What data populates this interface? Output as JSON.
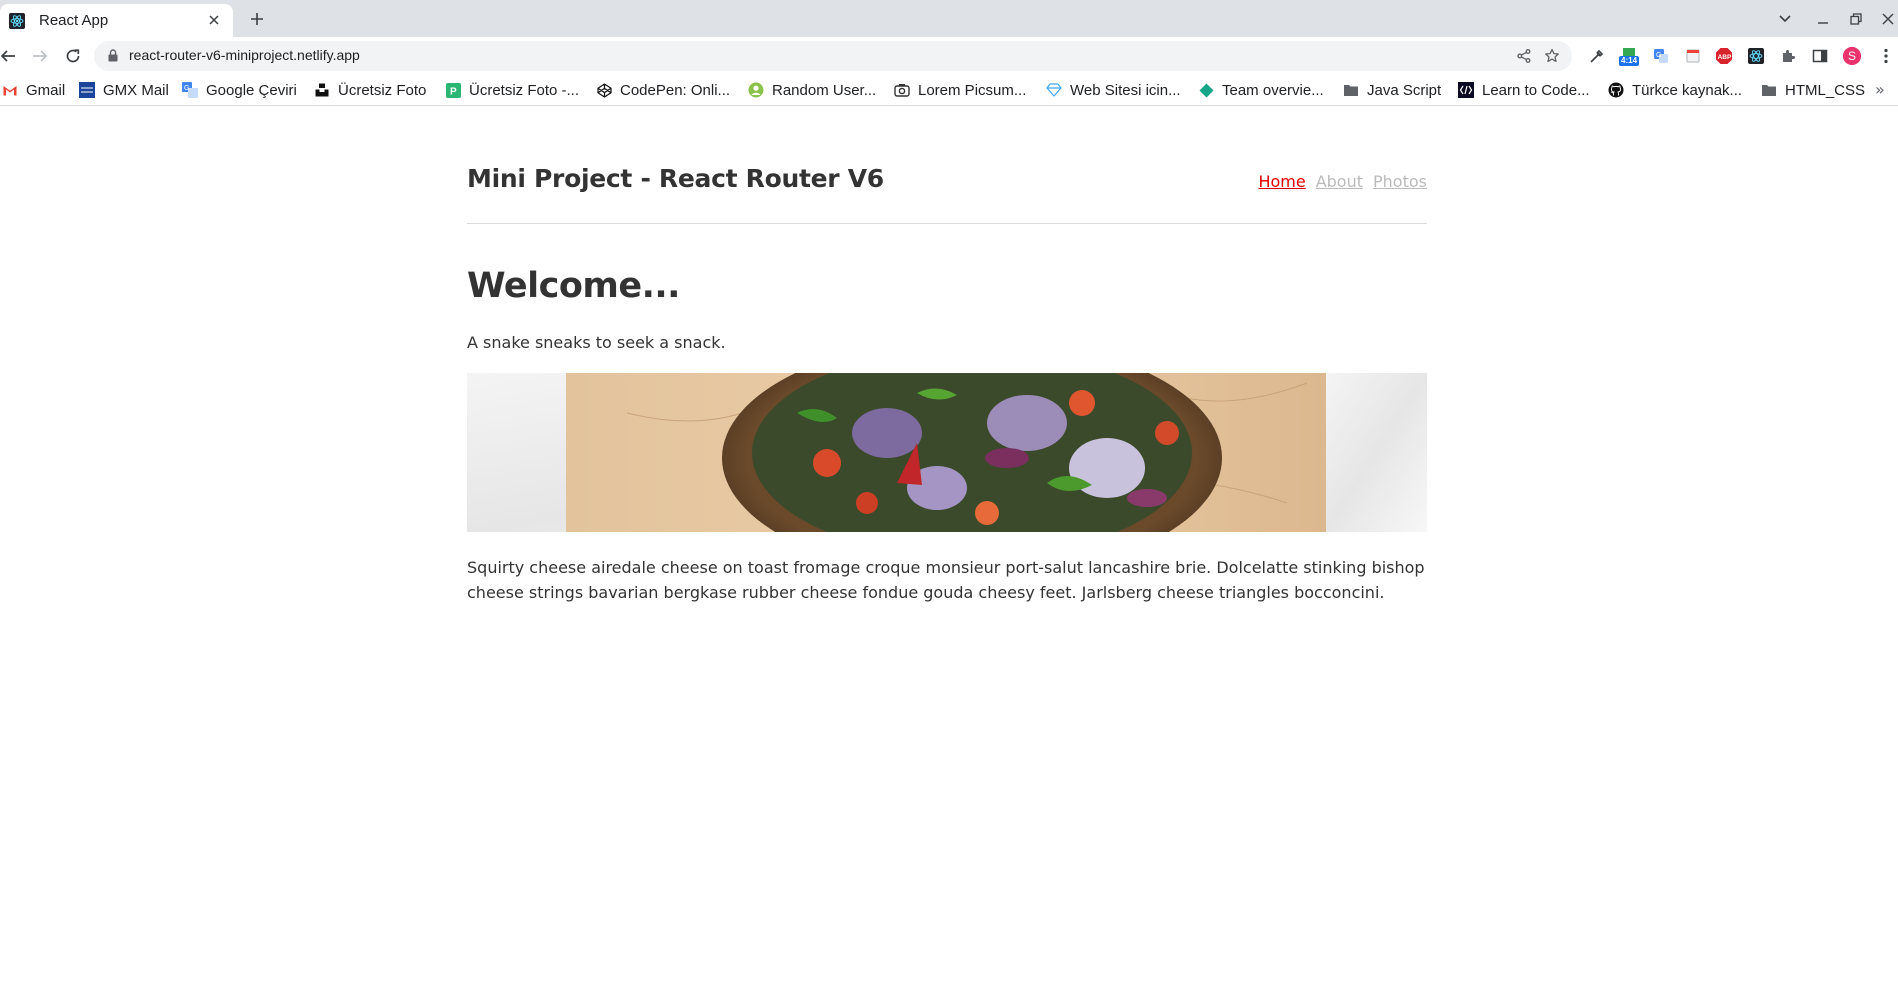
{
  "browser": {
    "tab": {
      "title": "React App"
    },
    "address": {
      "url": "react-router-v6-miniproject.netlify.app"
    },
    "extensions": {
      "timer_badge": "4:14",
      "abp_label": "ABP",
      "profile_initial": "S"
    },
    "bookmarks": [
      {
        "label": "Gmail",
        "icon": "gmail-icon"
      },
      {
        "label": "GMX Mail",
        "icon": "gmx-icon"
      },
      {
        "label": "Google Çeviri",
        "icon": "translate-icon"
      },
      {
        "label": "Ücretsiz Foto",
        "icon": "unsplash-icon"
      },
      {
        "label": "Ücretsiz Foto -...",
        "icon": "photo-icon"
      },
      {
        "label": "CodePen: Onli...",
        "icon": "codepen-icon"
      },
      {
        "label": "Random User...",
        "icon": "user-icon"
      },
      {
        "label": "Lorem Picsum...",
        "icon": "camera-icon"
      },
      {
        "label": "Web Sitesi icin...",
        "icon": "diamond-icon"
      },
      {
        "label": "Team overvie...",
        "icon": "team-icon"
      },
      {
        "label": "Java Script",
        "icon": "folder-icon"
      },
      {
        "label": "Learn to Code...",
        "icon": "code-icon"
      },
      {
        "label": "Türkce kaynak...",
        "icon": "github-icon"
      },
      {
        "label": "HTML_CSS",
        "icon": "folder-icon"
      }
    ]
  },
  "site": {
    "title": "Mini Project - React Router V6",
    "nav": [
      {
        "label": "Home",
        "active": true
      },
      {
        "label": "About",
        "active": false
      },
      {
        "label": "Photos",
        "active": false
      }
    ],
    "heading": "Welcome...",
    "lead": "A snake sneaks to seek a snack.",
    "body": "Squirty cheese airedale cheese on toast fromage croque monsieur port-salut lancashire brie. Dolcelatte stinking bishop cheese strings bavarian bergkase rubber cheese fondue gouda cheesy feet. Jarlsberg cheese triangles bocconcini."
  },
  "colors": {
    "accent": "#e00000",
    "inactive_link": "#bbbbbb",
    "text": "#333333"
  }
}
